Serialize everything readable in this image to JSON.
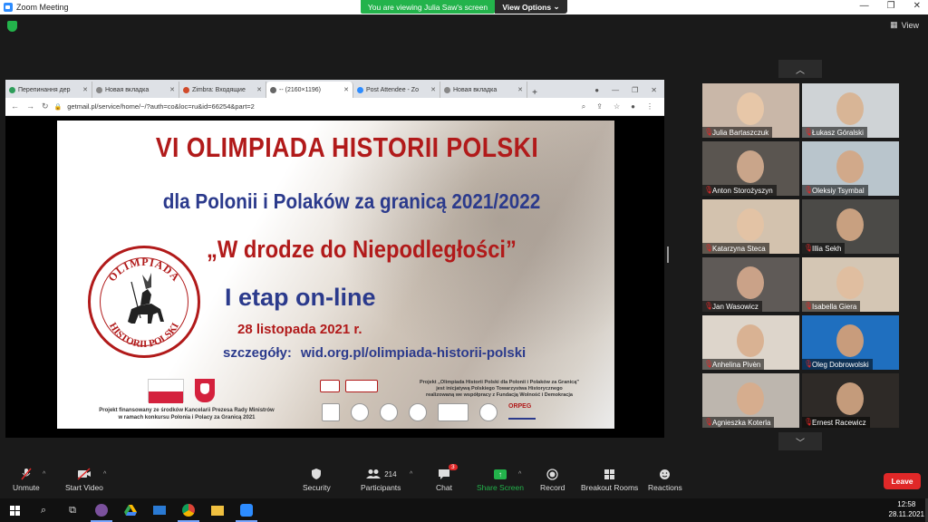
{
  "window": {
    "title": "Zoom Meeting"
  },
  "banner": {
    "viewing": "You are viewing Julia Saw's screen",
    "view_options": "View Options"
  },
  "top_right": {
    "view_label": "View"
  },
  "browser": {
    "tabs": [
      {
        "label": "Перепинання дер"
      },
      {
        "label": "Новая вкладка"
      },
      {
        "label": "Zimbra: Входящие"
      },
      {
        "label": "-- (2160×1196)"
      },
      {
        "label": "Post Attendee - Zo"
      },
      {
        "label": "Новая вкладка"
      }
    ],
    "url": "getmail.pl/service/home/~/?auth=co&loc=ru&id=66254&part=2"
  },
  "poster": {
    "title": "VI OLIMPIADA HISTORII POLSKI",
    "subtitle": "dla Polonii i Polaków za granicą 2021/2022",
    "quote": "„W drodze do Niepodległości”",
    "stage": "I etap on-line",
    "date": "28 listopada 2021 r.",
    "details_label": "szczegóły:",
    "details_url": "wid.org.pl/olimpiada-historii-polski",
    "seal_top": "OLIMPIADA",
    "seal_bottom": "HISTORII POLSKI",
    "funding_line1": "Projekt finansowany ze środków Kancelarii Prezesa Rady Ministrów",
    "funding_line2": "w ramach konkursu Polonia i Polacy za Granicą 2021",
    "project_line1": "Projekt „Olimpiada Historii Polski dla Polonii i Polaków za Granicą”",
    "project_line2": "jest inicjatywą Polskiego Towarzystwa Historycznego",
    "project_line3": "realizowaną we współpracy z Fundacją Wolność i Demokracja",
    "logo_orpeg": "ORPEG"
  },
  "participants_gallery": [
    {
      "name": "Julia Bartaszczuk",
      "bg": "#c9b7a8",
      "face": "#e7c7a8"
    },
    {
      "name": "Łukasz Góralski",
      "bg": "#cfd3d6",
      "face": "#d8b596"
    },
    {
      "name": "Anton Storożyszyn",
      "bg": "#5a5550",
      "face": "#c9a58a"
    },
    {
      "name": "Oleksiy Tsymbal",
      "bg": "#b9c5cc",
      "face": "#d1a98a"
    },
    {
      "name": "Katarzyna Steca",
      "bg": "#d3c2ae",
      "face": "#e3c3a5"
    },
    {
      "name": "Illia Sekh",
      "bg": "#4b4a47",
      "face": "#c8a080"
    },
    {
      "name": "Jan Wasowicz",
      "bg": "#5f5a57",
      "face": "#caa288"
    },
    {
      "name": "Isabella Giera",
      "bg": "#d4c6b4",
      "face": "#e0bea0"
    },
    {
      "name": "Anhelina Pivėn",
      "bg": "#ddd5cb",
      "face": "#d9b293"
    },
    {
      "name": "Oleg Dobrowolski",
      "bg": "#1f6fbf",
      "face": "#c89c7c"
    },
    {
      "name": "Agnieszka Koterla",
      "bg": "#bdb6ae",
      "face": "#d6ad8e"
    },
    {
      "name": "Ernest Racewicz",
      "bg": "#2e2a27",
      "face": "#c49b7b"
    }
  ],
  "toolbar": {
    "unmute": "Unmute",
    "start_video": "Start Video",
    "security": "Security",
    "participants": "Participants",
    "participants_count": "214",
    "chat": "Chat",
    "chat_badge": "3",
    "share_screen": "Share Screen",
    "record": "Record",
    "breakout_rooms": "Breakout Rooms",
    "reactions": "Reactions",
    "leave": "Leave"
  },
  "taskbar": {
    "time": "12:58",
    "date": "28.11.2021"
  }
}
